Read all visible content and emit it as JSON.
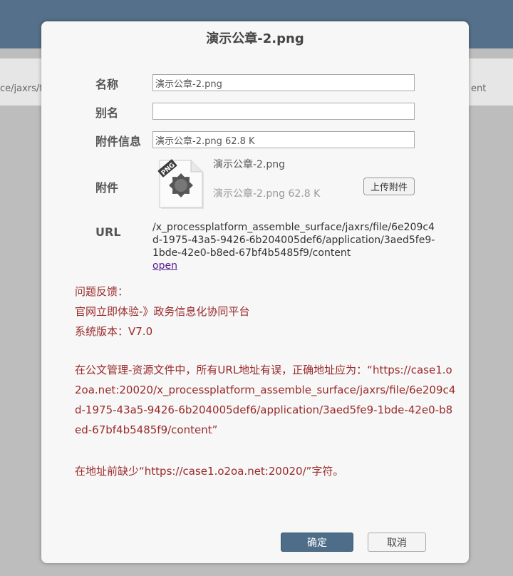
{
  "background": {
    "left_fragment": "ce/jaxrs/fil",
    "right_fragment": "ent"
  },
  "dialog": {
    "title": "演示公章-2.png",
    "labels": {
      "name": "名称",
      "alias": "别名",
      "attachment_info": "附件信息",
      "attachment": "附件",
      "url": "URL"
    },
    "fields": {
      "name_value": "演示公章-2.png",
      "alias_value": "",
      "attachment_info_value": "演示公章-2.png 62.8 K"
    },
    "attachment": {
      "file_type_badge": "PNG",
      "icon": "png-file-icon",
      "name": "演示公章-2.png",
      "info": "演示公章-2.png 62.8 K",
      "upload_label": "上传附件"
    },
    "url": {
      "path": "/x_processplatform_assemble_surface/jaxrs/file/6e209c4d-1975-43a5-9426-6b204005def6/application/3aed5fe9-1bde-42e0-b8ed-67bf4b5485f9/content",
      "open_label": "open"
    },
    "notes": {
      "feedback": "问题反馈：",
      "site": "官网立即体验-》政务信息化协同平台",
      "version": "系统版本：V7.0",
      "problem_detail": "在公文管理-资源文件中，所有URL地址有误，正确地址应为：“https://case1.o2oa.net:20020/x_processplatform_assemble_surface/jaxrs/file/6e209c4d-1975-43a5-9426-6b204005def6/application/3aed5fe9-1bde-42e0-b8ed-67bf4b5485f9/content”",
      "missing_prefix": "在地址前缺少“https://case1.o2oa.net:20020/”字符。"
    },
    "buttons": {
      "confirm": "确定",
      "cancel": "取消"
    }
  },
  "colors": {
    "header": "#55708a",
    "note_text": "#9b2a2a",
    "primary_button": "#4e6d89"
  }
}
